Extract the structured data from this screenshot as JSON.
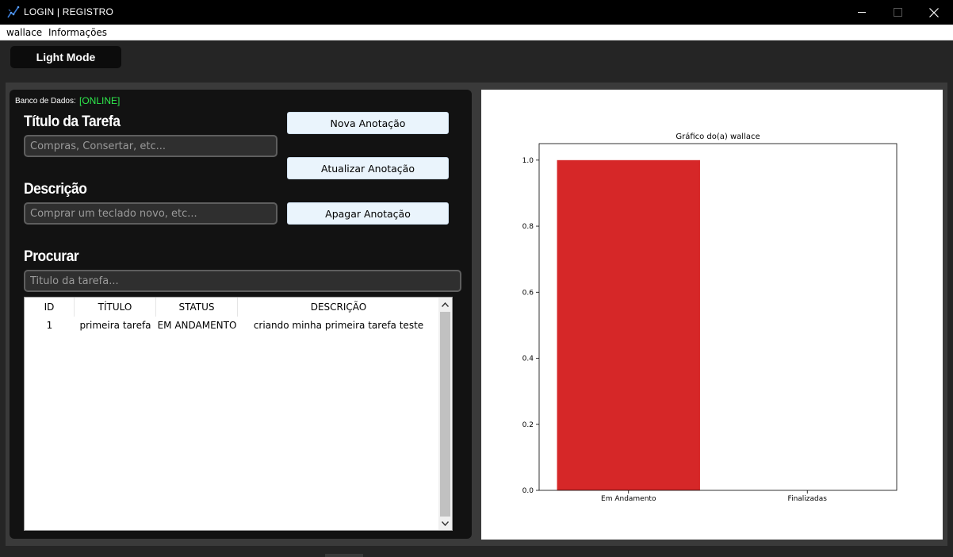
{
  "window": {
    "title": "LOGIN | REGISTRO"
  },
  "menu": {
    "items": [
      "wallace",
      "Informações"
    ]
  },
  "mode_button": "Light Mode",
  "database": {
    "label": "Banco de Dados:",
    "status": "[ONLINE]",
    "status_color": "#2ee84c"
  },
  "form": {
    "title_label": "Título da Tarefa",
    "title_placeholder": "Compras, Consertar, etc...",
    "desc_label": "Descrição",
    "desc_placeholder": "Comprar um teclado novo, etc...",
    "search_label": "Procurar",
    "search_placeholder": "Titulo da tarefa..."
  },
  "buttons": {
    "new": "Nova Anotação",
    "update": "Atualizar Anotação",
    "delete": "Apagar Anotação"
  },
  "table": {
    "columns": [
      "ID",
      "TÍTULO",
      "STATUS",
      "DESCRIÇÃO"
    ],
    "rows": [
      [
        "1",
        "primeira tarefa",
        "EM ANDAMENTO",
        "criando minha primeira tarefa teste"
      ]
    ]
  },
  "chart_data": {
    "type": "bar",
    "title": "Gráfico do(a) wallace",
    "categories": [
      "Em Andamento",
      "Finalizadas"
    ],
    "values": [
      1.0,
      0.0
    ],
    "ylim": [
      0,
      1.05
    ],
    "yticks": [
      "0.0",
      "0.2",
      "0.4",
      "0.6",
      "0.8",
      "1.0"
    ],
    "bar_color": "#d62728",
    "grid": false
  }
}
